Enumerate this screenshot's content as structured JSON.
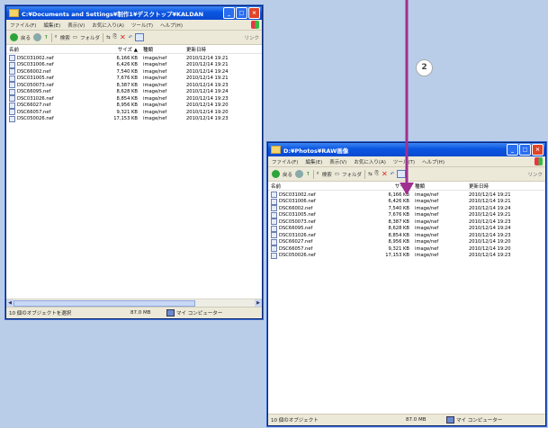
{
  "windows": [
    {
      "title": "C:¥Documents and Settings¥制作1¥デスクトップ¥KALDAN",
      "menu": [
        "ファイル(F)",
        "編集(E)",
        "表示(V)",
        "お気に入り(A)",
        "ツール(T)",
        "ヘルプ(H)"
      ],
      "toolbar": {
        "back": "戻る",
        "search": "検索",
        "folders": "フォルダ",
        "links": "リンク"
      },
      "headers": {
        "name": "名前",
        "size": "サイズ ▲",
        "type": "種類",
        "date": "更新日時"
      },
      "files": [
        {
          "name": "DSC031002.nef",
          "size": "6,166 KB",
          "type": "image/nef",
          "date": "2010/12/14 19:21"
        },
        {
          "name": "DSC031006.nef",
          "size": "6,426 KB",
          "type": "image/nef",
          "date": "2010/12/14 19:21"
        },
        {
          "name": "DSC66002.nef",
          "size": "7,540 KB",
          "type": "image/nef",
          "date": "2010/12/14 19:24"
        },
        {
          "name": "DSC031005.nef",
          "size": "7,676 KB",
          "type": "image/nef",
          "date": "2010/12/14 19:21"
        },
        {
          "name": "DSC050073.nef",
          "size": "8,387 KB",
          "type": "image/nef",
          "date": "2010/12/14 19:23"
        },
        {
          "name": "DSC66095.nef",
          "size": "8,628 KB",
          "type": "image/nef",
          "date": "2010/12/14 19:24"
        },
        {
          "name": "DSC031026.nef",
          "size": "8,854 KB",
          "type": "image/nef",
          "date": "2010/12/14 19:23"
        },
        {
          "name": "DSC66027.nef",
          "size": "8,956 KB",
          "type": "image/nef",
          "date": "2010/12/14 19:20"
        },
        {
          "name": "DSC66057.nef",
          "size": "9,321 KB",
          "type": "image/nef",
          "date": "2010/12/14 19:20"
        },
        {
          "name": "DSC050026.nef",
          "size": "17,153 KB",
          "type": "image/nef",
          "date": "2010/12/14 19:23"
        }
      ],
      "status": {
        "selection": "10 個のオブジェクトを選択",
        "size": "87.0 MB",
        "location": "マイ コンピューター"
      }
    },
    {
      "title": "D:¥Photos¥RAW画像",
      "menu": [
        "ファイル(F)",
        "編集(E)",
        "表示(V)",
        "お気に入り(A)",
        "ツール(T)",
        "ヘルプ(H)"
      ],
      "toolbar": {
        "back": "戻る",
        "search": "検索",
        "folders": "フォルダ",
        "links": "リンク"
      },
      "headers": {
        "name": "名前",
        "size": "サイズ",
        "type": "種類",
        "date": "更新日時"
      },
      "files": [
        {
          "name": "DSC031002.nef",
          "size": "6,166 KB",
          "type": "image/nef",
          "date": "2010/12/14 19:21"
        },
        {
          "name": "DSC031006.nef",
          "size": "6,426 KB",
          "type": "image/nef",
          "date": "2010/12/14 19:21"
        },
        {
          "name": "DSC66002.nef",
          "size": "7,540 KB",
          "type": "image/nef",
          "date": "2010/12/14 19:24"
        },
        {
          "name": "DSC031005.nef",
          "size": "7,676 KB",
          "type": "image/nef",
          "date": "2010/12/14 19:21"
        },
        {
          "name": "DSC050073.nef",
          "size": "8,387 KB",
          "type": "image/nef",
          "date": "2010/12/14 19:23"
        },
        {
          "name": "DSC66095.nef",
          "size": "8,628 KB",
          "type": "image/nef",
          "date": "2010/12/14 19:24"
        },
        {
          "name": "DSC031026.nef",
          "size": "8,854 KB",
          "type": "image/nef",
          "date": "2010/12/14 19:23"
        },
        {
          "name": "DSC66027.nef",
          "size": "8,956 KB",
          "type": "image/nef",
          "date": "2010/12/14 19:20"
        },
        {
          "name": "DSC66057.nef",
          "size": "9,321 KB",
          "type": "image/nef",
          "date": "2010/12/14 19:20"
        },
        {
          "name": "DSC050026.nef",
          "size": "17,153 KB",
          "type": "image/nef",
          "date": "2010/12/14 19:23"
        }
      ],
      "status": {
        "selection": "10 個のオブジェクト",
        "size": "87.0 MB",
        "location": "マイ コンピューター"
      }
    }
  ],
  "annotation": {
    "step": "2"
  },
  "colors": {
    "desktop": "#b9cde8",
    "titlebar": "#0a55e0",
    "arrow": "#a0308f"
  }
}
